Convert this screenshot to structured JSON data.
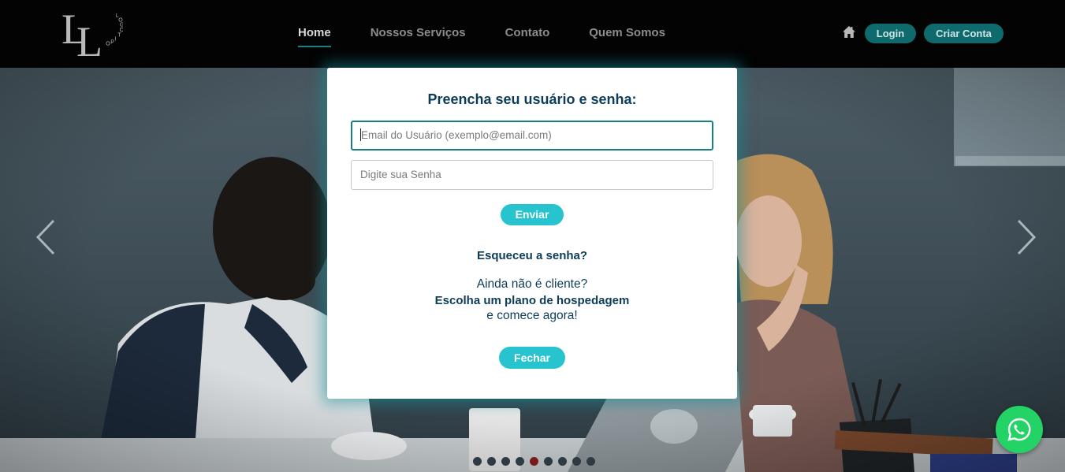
{
  "header": {
    "logo": {
      "letters": [
        "L",
        "L"
      ],
      "word": "LOGOTIPO"
    },
    "nav": [
      {
        "label": "Home",
        "active": true
      },
      {
        "label": "Nossos Serviços",
        "active": false
      },
      {
        "label": "Contato",
        "active": false
      },
      {
        "label": "Quem Somos",
        "active": false
      }
    ],
    "home_icon": "home-icon",
    "login_label": "Login",
    "criar_conta_label": "Criar Conta"
  },
  "carousel": {
    "prev_icon": "chevron-left-icon",
    "next_icon": "chevron-right-icon",
    "slide_count": 9,
    "active_slide": 5
  },
  "modal": {
    "title": "Preencha seu usuário e senha:",
    "email_placeholder": "Email do Usuário (exemplo@email.com)",
    "password_placeholder": "Digite sua Senha",
    "submit_label": "Enviar",
    "forgot_label": "Esqueceu a senha?",
    "not_client": "Ainda não é cliente?",
    "choose_plan": "Escolha um plano de hospedagem",
    "start_now": "e comece agora!",
    "close_label": "Fechar"
  },
  "whatsapp": {
    "icon": "whatsapp-icon"
  },
  "colors": {
    "accent": "#27c4cf",
    "header_button": "#0f6a6e",
    "title_text": "#0c3c58",
    "whatsapp": "#24d366",
    "active_dot": "#7a1b1b"
  }
}
